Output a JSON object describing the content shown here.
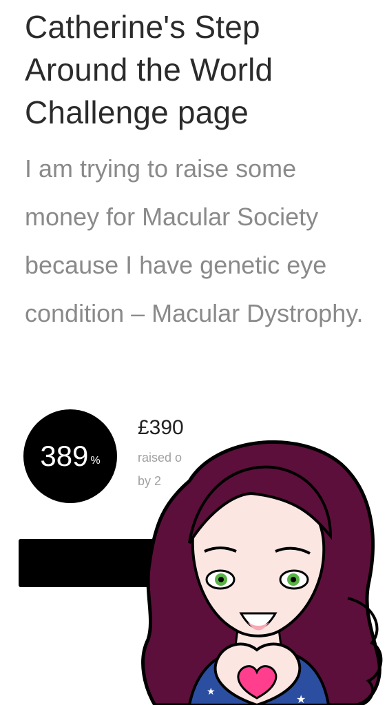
{
  "page": {
    "title": "Catherine's Step Around the World Challenge page",
    "description": "I am trying to raise some money for Macular Society because I have genetic eye condition – Macular Dystrophy."
  },
  "progress": {
    "percent": "389",
    "unit": "%"
  },
  "fundraising": {
    "amount": "£390",
    "raised_label": "raised o",
    "by_label": "by 2"
  },
  "donate_button": {
    "label": ""
  },
  "avatar": {
    "icon": "cartoon-avatar-heart-hands",
    "hair_color": "#5c0f3a",
    "skin_color": "#fbe6e2",
    "shirt_color": "#2b4ea0",
    "heart_color": "#ff3f8e"
  }
}
